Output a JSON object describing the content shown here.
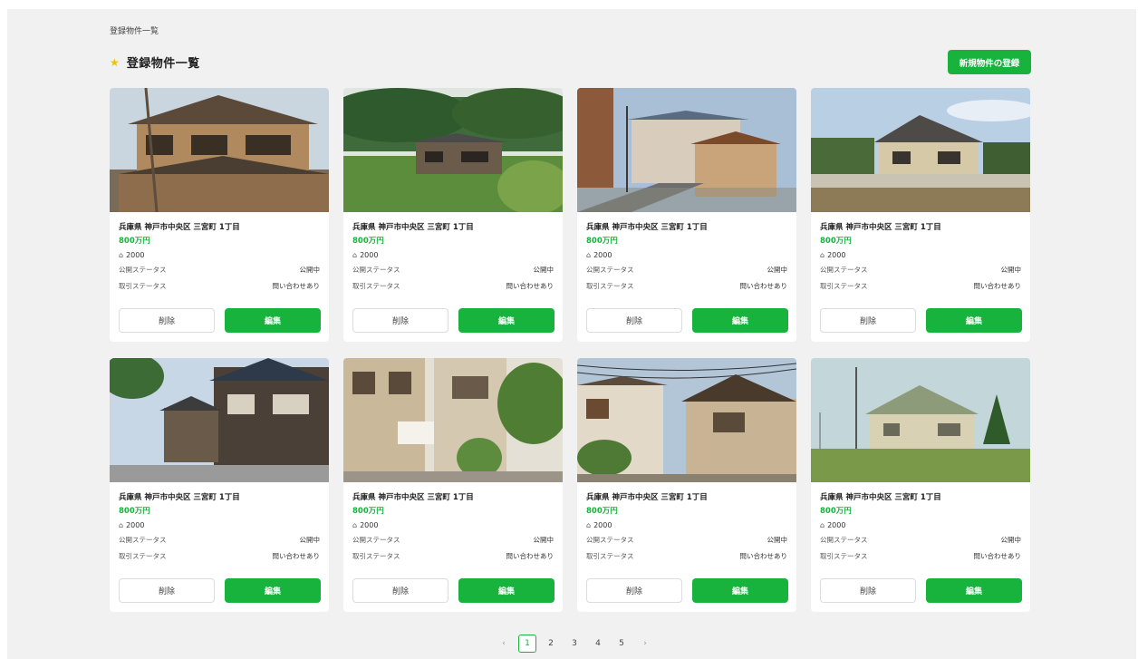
{
  "breadcrumb": "登録物件一覧",
  "header": {
    "title": "登録物件一覧",
    "register_label": "新規物件の登録"
  },
  "colors": {
    "accent": "#18b33c",
    "star": "#f2c200",
    "background": "#f1f1f1"
  },
  "status_labels": {
    "publish": "公開ステータス",
    "deal": "取引ステータス"
  },
  "button_labels": {
    "delete": "削除",
    "edit": "編集"
  },
  "area_icon": "area-icon",
  "properties": [
    {
      "address": "兵庫県 神戸市中央区 三宮町 1丁目",
      "price": "800万円",
      "area": "2000",
      "publish_status": "公開中",
      "deal_status": "問い合わせあり",
      "photo": "traditional-wooden-house"
    },
    {
      "address": "兵庫県 神戸市中央区 三宮町 1丁目",
      "price": "800万円",
      "area": "2000",
      "publish_status": "公開中",
      "deal_status": "問い合わせあり",
      "photo": "farmhouse-in-forest"
    },
    {
      "address": "兵庫県 神戸市中央区 三宮町 1丁目",
      "price": "800万円",
      "area": "2000",
      "publish_status": "公開中",
      "deal_status": "問い合わせあり",
      "photo": "street-with-houses"
    },
    {
      "address": "兵庫県 神戸市中央区 三宮町 1丁目",
      "price": "800万円",
      "area": "2000",
      "publish_status": "公開中",
      "deal_status": "問い合わせあり",
      "photo": "house-behind-wall"
    },
    {
      "address": "兵庫県 神戸市中央区 三宮町 1丁目",
      "price": "800万円",
      "area": "2000",
      "publish_status": "公開中",
      "deal_status": "問い合わせあり",
      "photo": "town-street-corner"
    },
    {
      "address": "兵庫県 神戸市中央区 三宮町 1丁目",
      "price": "800万円",
      "area": "2000",
      "publish_status": "公開中",
      "deal_status": "問い合わせあり",
      "photo": "residential-alley"
    },
    {
      "address": "兵庫県 神戸市中央区 三宮町 1丁目",
      "price": "800万円",
      "area": "2000",
      "publish_status": "公開中",
      "deal_status": "問い合わせあり",
      "photo": "old-house-with-wires"
    },
    {
      "address": "兵庫県 神戸市中央区 三宮町 1丁目",
      "price": "800万円",
      "area": "2000",
      "publish_status": "公開中",
      "deal_status": "問い合わせあり",
      "photo": "house-in-field"
    }
  ],
  "pagination": {
    "prev": "‹",
    "next": "›",
    "pages": [
      "1",
      "2",
      "3",
      "4",
      "5"
    ],
    "current": "1"
  }
}
